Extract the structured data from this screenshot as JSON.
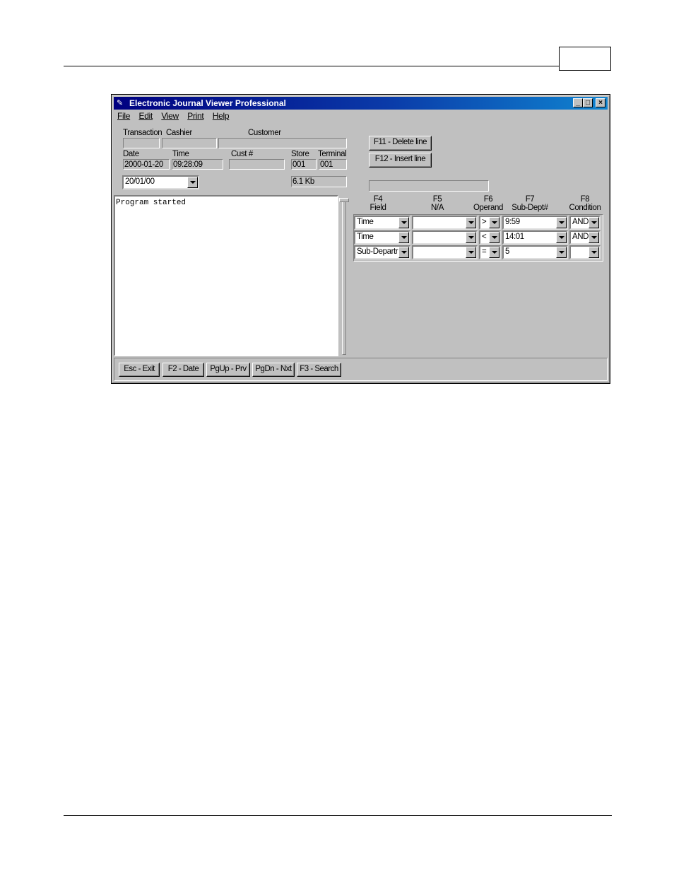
{
  "window": {
    "title": "Electronic Journal Viewer Professional",
    "menu": [
      "File",
      "Edit",
      "View",
      "Print",
      "Help"
    ]
  },
  "info": {
    "labels": {
      "transaction": "Transaction",
      "cashier": "Cashier",
      "customer": "Customer",
      "date": "Date",
      "time": "Time",
      "cust_no": "Cust #",
      "store": "Store",
      "terminal": "Terminal"
    },
    "values": {
      "transaction": "",
      "cashier": "",
      "customer": "",
      "date": "2000-01-20",
      "time": "09:28:09",
      "cust_no": "",
      "store": "001",
      "terminal": "001",
      "size": "6.1 Kb"
    },
    "date_select": "20/01/00"
  },
  "log": {
    "text": "Program started"
  },
  "buttons": {
    "delete_line": "F11 - Delete line",
    "insert_line": "F12 - Insert line",
    "progress_text": ""
  },
  "grid": {
    "headers": [
      {
        "key": "F4",
        "label": "Field"
      },
      {
        "key": "F5",
        "label": "N/A"
      },
      {
        "key": "F6",
        "label": "Operand"
      },
      {
        "key": "F7",
        "label": "Sub-Dept#"
      },
      {
        "key": "F8",
        "label": "Condition"
      }
    ],
    "rows": [
      {
        "field": "Time",
        "na": "",
        "operand": ">",
        "value": "9:59",
        "condition": "AND"
      },
      {
        "field": "Time",
        "na": "",
        "operand": "<",
        "value": "14:01",
        "condition": "AND"
      },
      {
        "field": "Sub-Departr",
        "na": "",
        "operand": "=",
        "value": "5",
        "condition": ""
      }
    ]
  },
  "status_buttons": [
    "Esc - Exit",
    "F2 - Date",
    "PgUp - Prv",
    "PgDn - Nxt",
    "F3 - Search"
  ]
}
